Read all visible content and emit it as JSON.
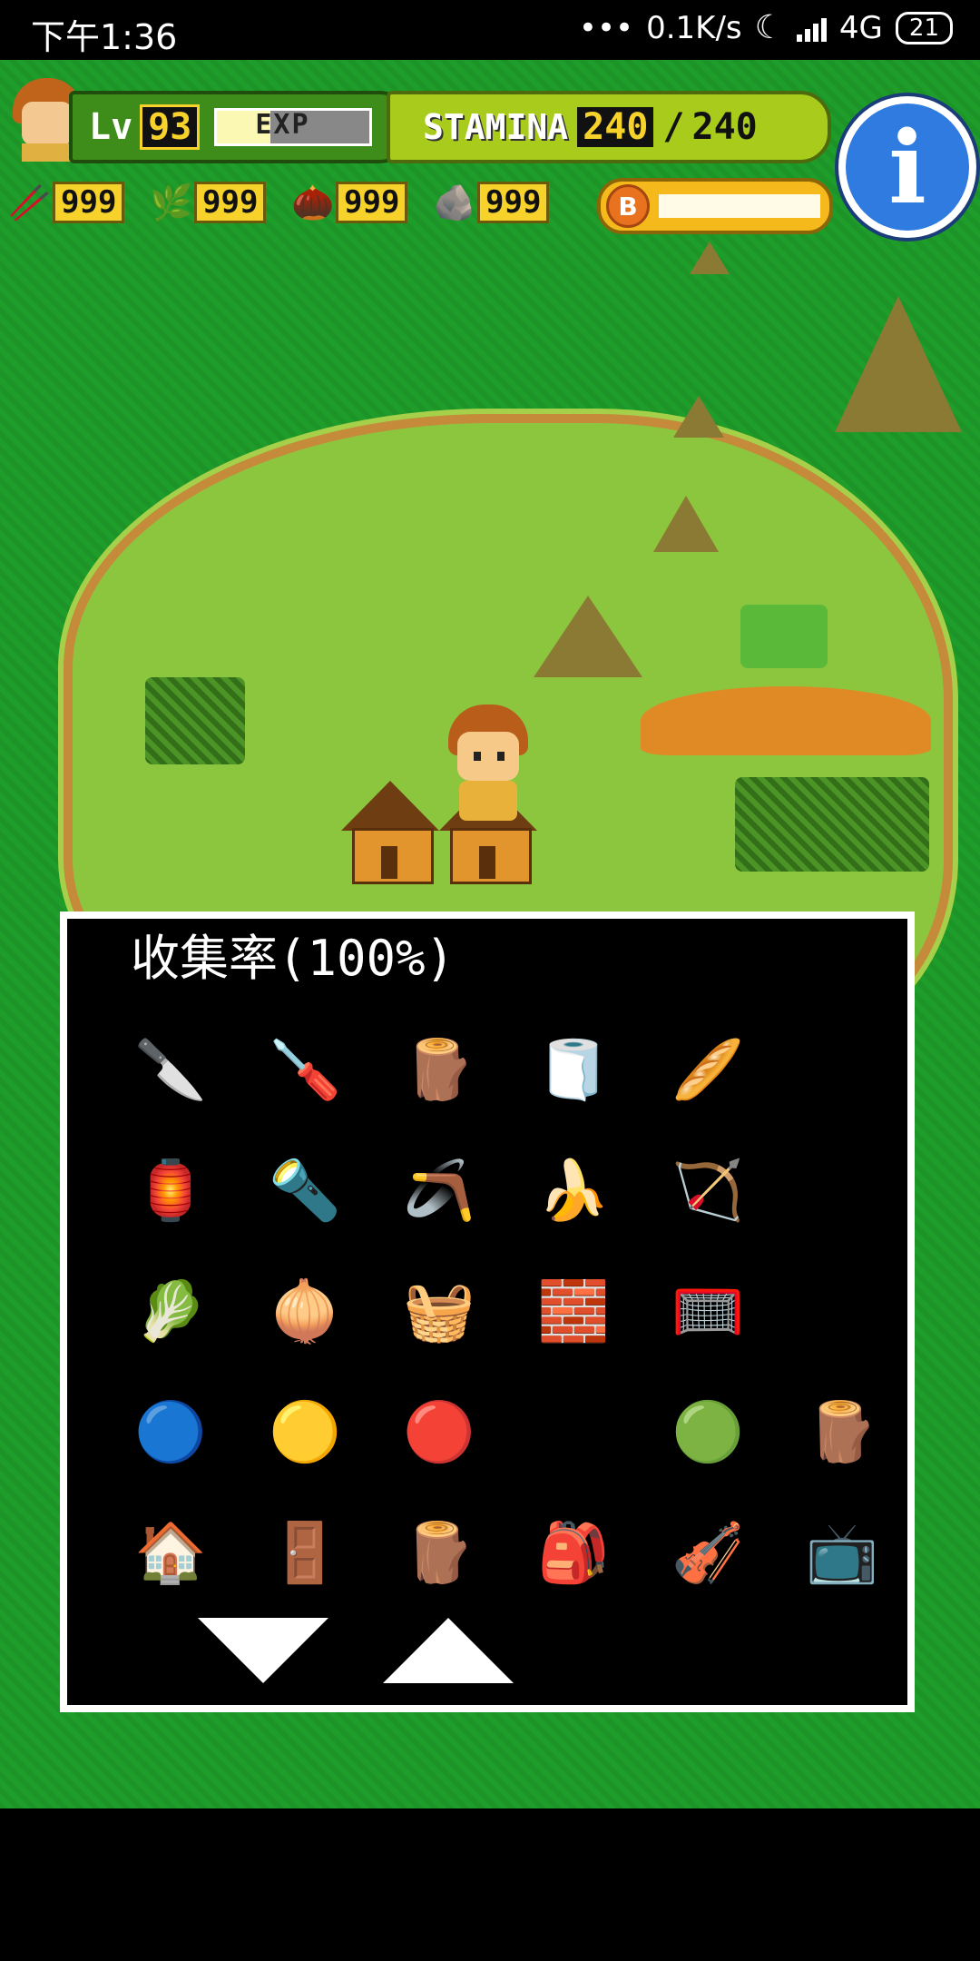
{
  "status_bar": {
    "time": "下午1:36",
    "network_speed": "0.1K/s",
    "network_type": "4G",
    "battery": "21"
  },
  "hud": {
    "level_label": "Lv",
    "level_value": "93",
    "exp_label": "EXP",
    "exp_progress": 0.35,
    "stamina_label": "STAMINA",
    "stamina_value": "240",
    "stamina_separator": "/",
    "stamina_max": "240",
    "info_label": "i",
    "coin_label": "B",
    "resources": [
      {
        "icon": "stick-icon",
        "value": "999"
      },
      {
        "icon": "leaf-icon",
        "value": "999"
      },
      {
        "icon": "nut-icon",
        "value": "999"
      },
      {
        "icon": "stone-icon",
        "value": "999"
      }
    ]
  },
  "collection": {
    "title": "收集率(100%)",
    "items": [
      {
        "name": "knife-icon",
        "glyph": "🔪"
      },
      {
        "name": "drill-icon",
        "glyph": "🪛"
      },
      {
        "name": "log-icon",
        "glyph": "🪵"
      },
      {
        "name": "blue-log-icon",
        "glyph": "🧻"
      },
      {
        "name": "orange-log-icon",
        "glyph": "🥖"
      },
      {
        "name": "candle-icon",
        "glyph": "🕯"
      },
      {
        "name": "lantern-icon",
        "glyph": "🏮"
      },
      {
        "name": "flashlight-icon",
        "glyph": "🔦"
      },
      {
        "name": "boomerang-brown-icon",
        "glyph": "🪃"
      },
      {
        "name": "boomerang-yellow-icon",
        "glyph": "🍌"
      },
      {
        "name": "bow-icon",
        "glyph": "🏹"
      },
      {
        "name": "arrow-icon",
        "glyph": "➹"
      },
      {
        "name": "green-net-icon",
        "glyph": "🥬"
      },
      {
        "name": "orange-net-icon",
        "glyph": "🧅"
      },
      {
        "name": "basket-icon",
        "glyph": "🧺"
      },
      {
        "name": "stone-block-icon",
        "glyph": "🧱"
      },
      {
        "name": "bug-net-icon",
        "glyph": "🥅"
      },
      {
        "name": "easel-icon",
        "glyph": "⚓"
      },
      {
        "name": "blue-ball-icon",
        "glyph": "🔵"
      },
      {
        "name": "yellow-ball-icon",
        "glyph": "🟡"
      },
      {
        "name": "red-ball-icon",
        "glyph": "🔴"
      },
      {
        "name": "grey-ball-icon",
        "glyph": "⚪"
      },
      {
        "name": "green-ball-icon",
        "glyph": "🟢"
      },
      {
        "name": "log-pile-icon",
        "glyph": "🪵"
      },
      {
        "name": "house-icon",
        "glyph": "🏠"
      },
      {
        "name": "fence-icon",
        "glyph": "🚪"
      },
      {
        "name": "big-log-icon",
        "glyph": "🪵"
      },
      {
        "name": "backpack-icon",
        "glyph": "🎒"
      },
      {
        "name": "violin-icon",
        "glyph": "🎻"
      },
      {
        "name": "tv-icon",
        "glyph": "📺"
      }
    ]
  },
  "colors": {
    "ocean": "#1f9d2a",
    "island": "#8cc63e",
    "hud_level": "#3e8d1a",
    "hud_stamina": "#a9cc1c",
    "accent_yellow": "#f6d22b",
    "info_blue": "#2f7be0"
  }
}
